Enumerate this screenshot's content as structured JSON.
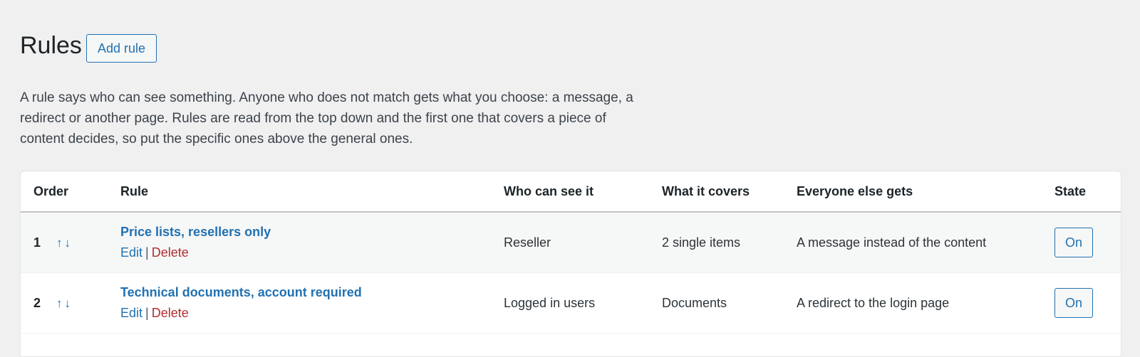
{
  "header": {
    "title": "Rules",
    "add_button_label": "Add rule"
  },
  "intro_text": "A rule says who can see something. Anyone who does not match gets what you choose: a message, a redirect or another page. Rules are read from the top down and the first one that covers a piece of content decides, so put the specific ones above the general ones.",
  "table": {
    "columns": {
      "order": "Order",
      "rule": "Rule",
      "who": "Who can see it",
      "covers": "What it covers",
      "else": "Everyone else gets",
      "state": "State"
    },
    "rows": [
      {
        "order": "1",
        "up_arrow": "↑",
        "down_arrow": "↓",
        "rule_name": "Price lists, resellers only",
        "edit_label": "Edit",
        "separator": "|",
        "delete_label": "Delete",
        "who": "Reseller",
        "covers": "2 single items",
        "else": "A message instead of the content",
        "state": "On"
      },
      {
        "order": "2",
        "up_arrow": "↑",
        "down_arrow": "↓",
        "rule_name": "Technical documents, account required",
        "edit_label": "Edit",
        "separator": "|",
        "delete_label": "Delete",
        "who": "Logged in users",
        "covers": "Documents",
        "else": "A redirect to the login page",
        "state": "On"
      }
    ]
  },
  "colors": {
    "accent": "#2271b1",
    "danger": "#b32d2e",
    "background": "#f0f0f1"
  }
}
